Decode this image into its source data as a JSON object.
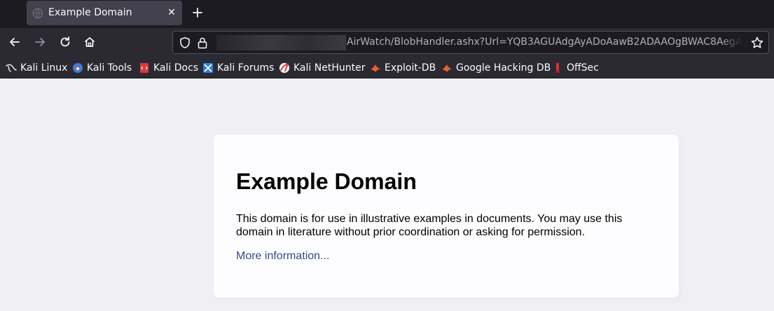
{
  "browser": {
    "tab": {
      "title": "Example Domain",
      "favicon": "globe-icon",
      "close_icon": "close-icon"
    },
    "new_tab_icon": "plus-icon",
    "nav": {
      "back_icon": "back-arrow-icon",
      "forward_icon": "forward-arrow-icon",
      "reload_icon": "reload-icon",
      "home_icon": "home-icon"
    },
    "url": {
      "visible_text": "AirWatch/BlobHandler.ashx?Url=YQB3AGUAdgAyADoAawB2ADAAOgBWAC8AegA",
      "shield_icon": "shield-icon",
      "lock_icon": "lock-icon",
      "bookmark_icon": "star-icon"
    },
    "bookmarks": [
      {
        "label": "Kali Linux",
        "icon": "kali-dragon-icon"
      },
      {
        "label": "Kali Tools",
        "icon": "kali-tools-icon"
      },
      {
        "label": "Kali Docs",
        "icon": "kali-docs-icon"
      },
      {
        "label": "Kali Forums",
        "icon": "kali-forums-icon"
      },
      {
        "label": "Kali NetHunter",
        "icon": "nethunter-icon"
      },
      {
        "label": "Exploit-DB",
        "icon": "exploit-db-icon"
      },
      {
        "label": "Google Hacking DB",
        "icon": "ghdb-icon"
      },
      {
        "label": "OffSec",
        "icon": "offsec-icon"
      }
    ]
  },
  "page": {
    "heading": "Example Domain",
    "description": "This domain is for use in illustrative examples in documents. You may use this domain in literature without prior coordination or asking for permission.",
    "link_text": "More information..."
  },
  "colors": {
    "tabstrip_bg": "#1c1b22",
    "toolbar_bg": "#2b2a33",
    "page_bg": "#f0f0f2",
    "card_bg": "#fdfdff",
    "link": "#38488f"
  }
}
